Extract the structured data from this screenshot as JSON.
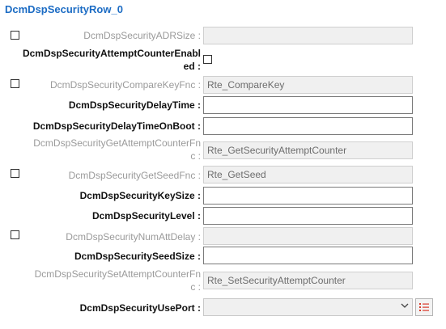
{
  "title": "DcmDspSecurityRow_0",
  "rows": {
    "adr_size": {
      "label": "DcmDspSecurityADRSize :",
      "value": ""
    },
    "attempt_counter_enabled": {
      "label_line1": "DcmDspSecurityAttemptCounterEnabl",
      "label_line2": "ed :"
    },
    "compare_key_fnc": {
      "label": "DcmDspSecurityCompareKeyFnc :",
      "value": "Rte_CompareKey"
    },
    "delay_time": {
      "label": "DcmDspSecurityDelayTime :",
      "value": ""
    },
    "delay_time_on_boot": {
      "label": "DcmDspSecurityDelayTimeOnBoot :",
      "value": ""
    },
    "get_attempt_counter_fnc": {
      "label_line1": "DcmDspSecurityGetAttemptCounterFn",
      "label_line2": "c :",
      "value": "Rte_GetSecurityAttemptCounter"
    },
    "get_seed_fnc": {
      "label": "DcmDspSecurityGetSeedFnc :",
      "value": "Rte_GetSeed"
    },
    "key_size": {
      "label": "DcmDspSecurityKeySize :",
      "value": ""
    },
    "level": {
      "label": "DcmDspSecurityLevel :",
      "value": ""
    },
    "num_att_delay": {
      "label": "DcmDspSecurityNumAttDelay :",
      "value": ""
    },
    "seed_size": {
      "label": "DcmDspSecuritySeedSize :",
      "value": ""
    },
    "set_attempt_counter_fnc": {
      "label_line1": "DcmDspSecuritySetAttemptCounterFn",
      "label_line2": "c :",
      "value": "Rte_SetSecurityAttemptCounter"
    },
    "use_port": {
      "label": "DcmDspSecurityUsePort :",
      "value": ""
    }
  },
  "colors": {
    "title": "#1c6cc4",
    "list_icon": "#d93a2b"
  },
  "icons": {
    "dropdown": "chevron-down-icon",
    "list": "list-icon"
  }
}
